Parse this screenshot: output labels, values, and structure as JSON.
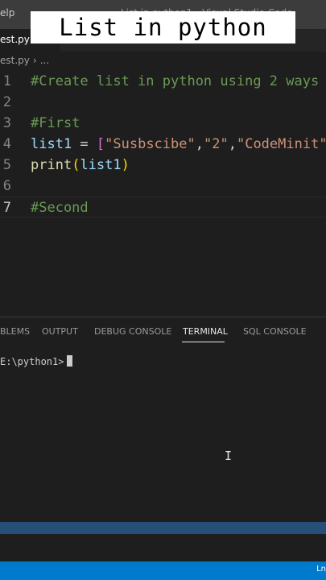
{
  "window": {
    "menu_item": "elp",
    "title": "List in python1 - Visual Studio Code"
  },
  "caption": "List in python",
  "tab": {
    "label": "est.py"
  },
  "breadcrumb": {
    "file": "est.py",
    "more": "..."
  },
  "editor": {
    "lines": [
      {
        "num": "1",
        "comment": "#Create list in python using 2 ways"
      },
      {
        "num": "2"
      },
      {
        "num": "3",
        "comment": "#First"
      },
      {
        "num": "4",
        "var": "list1",
        "op": " = ",
        "open": "[",
        "s1": "\"Susbscibe\"",
        "comma1": ",",
        "s2": "\"2\"",
        "comma2": ",",
        "s3": "\"CodeMinit\""
      },
      {
        "num": "5",
        "fn": "print",
        "open": "(",
        "arg": "list1",
        "close": ")"
      },
      {
        "num": "6"
      },
      {
        "num": "7",
        "comment": "#Second"
      }
    ]
  },
  "panel": {
    "tabs": [
      "BLEMS",
      "OUTPUT",
      "DEBUG CONSOLE",
      "TERMINAL",
      "SQL CONSOLE"
    ],
    "active_tab": "TERMINAL"
  },
  "terminal": {
    "prompt": "E:\\python1>"
  },
  "statusbar": {
    "right": "Ln"
  },
  "colors": {
    "accent": "#007acc",
    "selection": "#264f78",
    "comment": "#6a9955",
    "string": "#ce9178",
    "variable": "#9cdcfe",
    "function": "#dcdcaa"
  }
}
